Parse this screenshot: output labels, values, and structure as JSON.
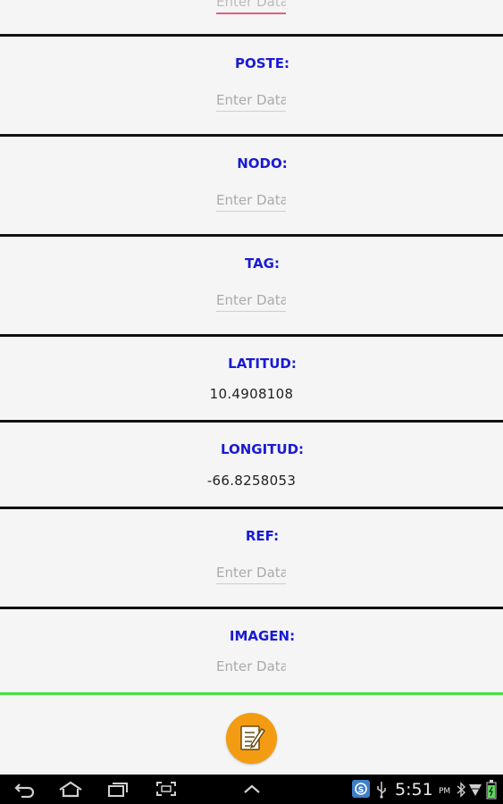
{
  "form": {
    "top_field_placeholder": "Enter Data",
    "fields": [
      {
        "label": "POSTE:",
        "placeholder": "Enter Data"
      },
      {
        "label": "NODO:",
        "placeholder": "Enter Data"
      },
      {
        "label": "TAG:",
        "placeholder": "Enter Data"
      },
      {
        "label": "LATITUD:",
        "value": "10.4908108"
      },
      {
        "label": "LONGITUD:",
        "value": "-66.8258053"
      },
      {
        "label": "REF:",
        "placeholder": "Enter Data"
      },
      {
        "label": "IMAGEN:",
        "placeholder": "Enter Data"
      }
    ]
  },
  "fab": {
    "icon": "edit-note-icon",
    "color": "#f39c12"
  },
  "colors": {
    "label": "#1a1ad6",
    "accent_line": "#44e244",
    "focus_underline": "#e0607e"
  },
  "navbar": {
    "icons": [
      "back-icon",
      "home-icon",
      "recent-apps-icon",
      "screenshot-icon",
      "chevron-up-icon"
    ],
    "status_icons": [
      "app-notification-icon",
      "usb-icon",
      "bluetooth-icon",
      "wifi-icon",
      "battery-icon"
    ],
    "time": "5:51",
    "ampm": "PM"
  }
}
